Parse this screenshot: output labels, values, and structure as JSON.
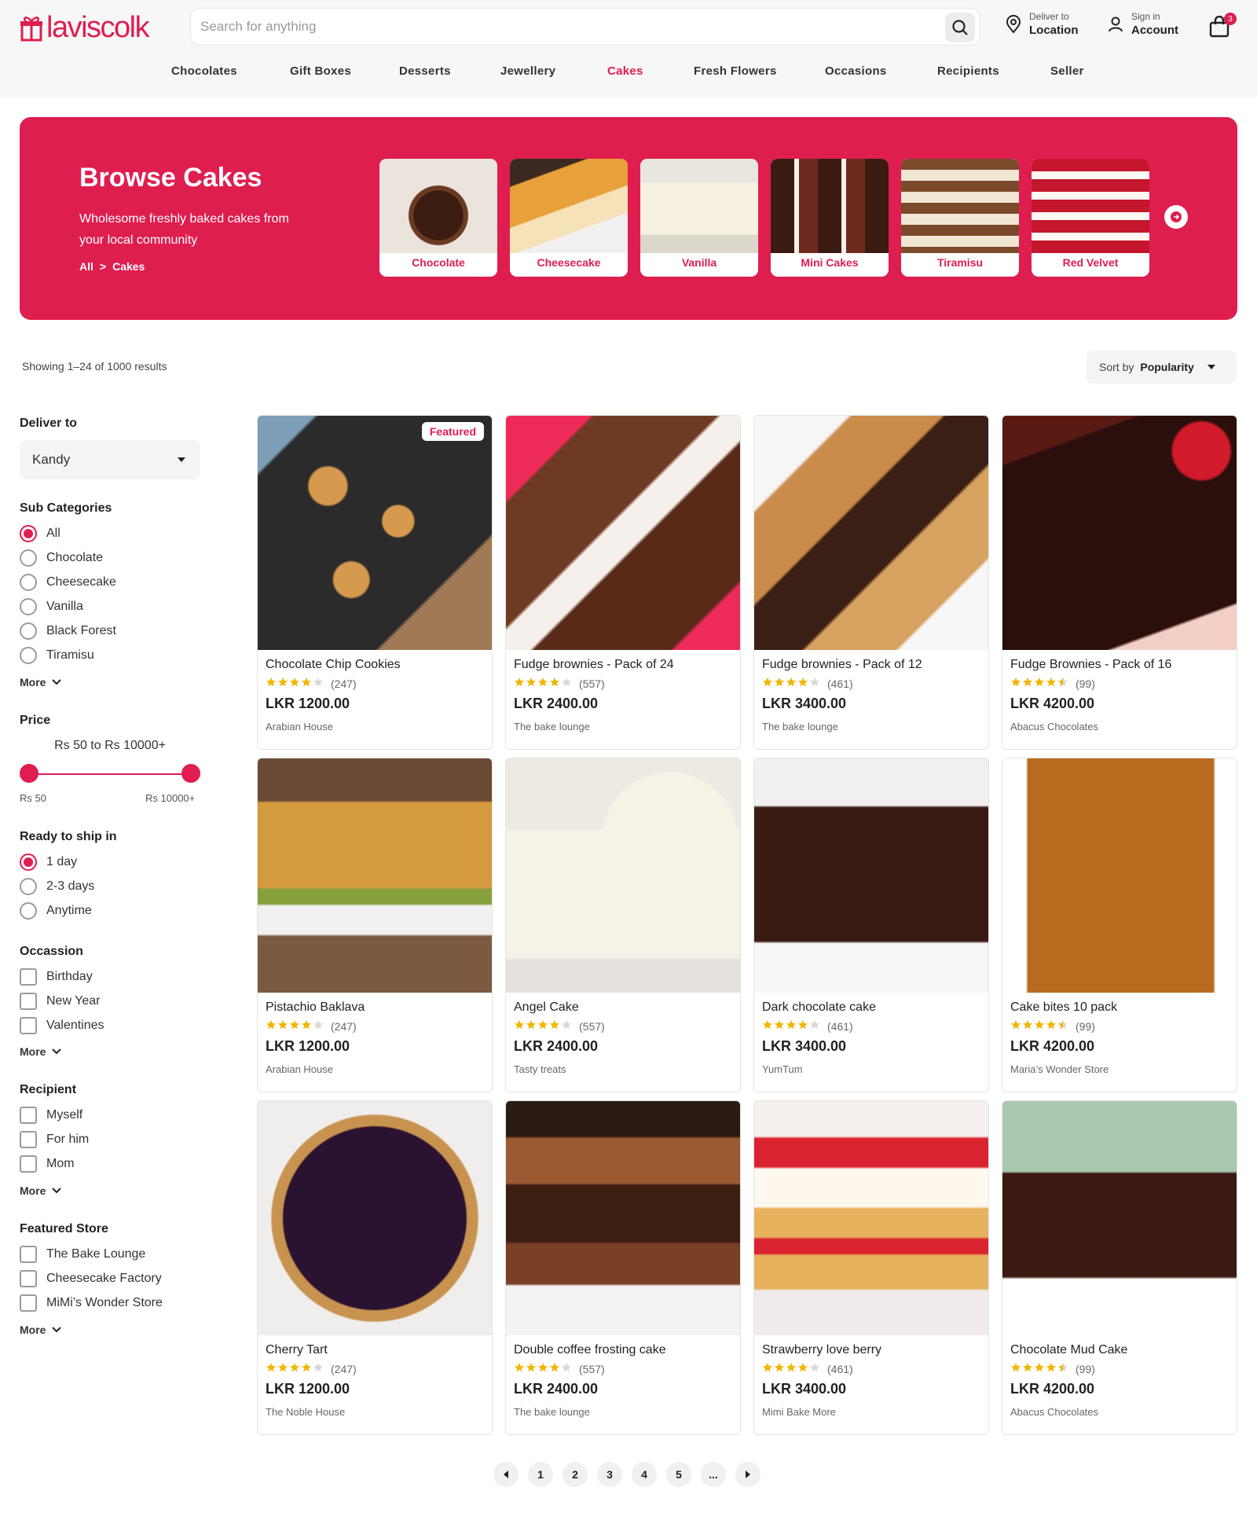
{
  "header": {
    "logo_text": "laviscolk",
    "search_placeholder": "Search for anything",
    "deliver_small": "Deliver to",
    "deliver_big": "Location",
    "account_small": "Sign in",
    "account_big": "Account",
    "cart_count": "3"
  },
  "nav": [
    "Chocolates",
    "Gift Boxes",
    "Desserts",
    "Jewellery",
    "Cakes",
    "Fresh Flowers",
    "Occasions",
    "Recipients",
    "Seller"
  ],
  "hero": {
    "title": "Browse Cakes",
    "subtitle": "Wholesome freshly baked cakes from your local community",
    "crumb_all": "All",
    "crumb_sep": ">",
    "crumb_current": "Cakes",
    "categories": [
      "Chocolate",
      "Cheesecake",
      "Vanilla",
      "Mini Cakes",
      "Tiramisu",
      "Red Velvet"
    ]
  },
  "results_text": "Showing 1–24 of 1000 results",
  "sort": {
    "label": "Sort by",
    "value": "Popularity"
  },
  "filters": {
    "deliver_title": "Deliver to",
    "deliver_value": "Kandy",
    "subcat_title": "Sub Categories",
    "subcats": [
      "All",
      "Chocolate",
      "Cheesecake",
      "Vanilla",
      "Black Forest",
      "Tiramisu"
    ],
    "more": "More",
    "price_title": "Price",
    "price_range": "Rs 50 to Rs 10000+",
    "price_min": "Rs 50",
    "price_max": "Rs 10000+",
    "ship_title": "Ready to ship in",
    "ship": [
      "1 day",
      "2-3 days",
      "Anytime"
    ],
    "occasion_title": "Occassion",
    "occasions": [
      "Birthday",
      "New Year",
      "Valentines"
    ],
    "recipient_title": "Recipient",
    "recipients": [
      "Myself",
      "For him",
      "Mom"
    ],
    "store_title": "Featured Store",
    "stores": [
      "The Bake Lounge",
      "Cheesecake Factory",
      "MiMi’s Wonder Store"
    ]
  },
  "featured_label": "Featured",
  "products": [
    {
      "title": "Chocolate Chip Cookies",
      "rating": 4,
      "reviews": "(247)",
      "price": "LKR 1200.00",
      "store": "Arabian House"
    },
    {
      "title": "Fudge brownies - Pack of 24",
      "rating": 4,
      "reviews": "(557)",
      "price": "LKR 2400.00",
      "store": "The bake lounge"
    },
    {
      "title": "Fudge brownies - Pack of 12",
      "rating": 4,
      "reviews": "(461)",
      "price": "LKR 3400.00",
      "store": "The bake lounge"
    },
    {
      "title": "Fudge Brownies - Pack of 16",
      "rating": 4.5,
      "reviews": "(99)",
      "price": "LKR 4200.00",
      "store": "Abacus Chocolates"
    },
    {
      "title": "Pistachio Baklava",
      "rating": 4,
      "reviews": "(247)",
      "price": "LKR 1200.00",
      "store": "Arabian House"
    },
    {
      "title": "Angel Cake",
      "rating": 4,
      "reviews": "(557)",
      "price": "LKR 2400.00",
      "store": "Tasty treats"
    },
    {
      "title": "Dark chocolate cake",
      "rating": 4,
      "reviews": "(461)",
      "price": "LKR 3400.00",
      "store": "YumTum"
    },
    {
      "title": "Cake bites 10 pack",
      "rating": 4.5,
      "reviews": "(99)",
      "price": "LKR 4200.00",
      "store": "Maria’s Wonder Store"
    },
    {
      "title": "Cherry Tart",
      "rating": 4,
      "reviews": "(247)",
      "price": "LKR 1200.00",
      "store": "The Noble House"
    },
    {
      "title": "Double coffee frosting cake",
      "rating": 4,
      "reviews": "(557)",
      "price": "LKR 2400.00",
      "store": "The bake lounge"
    },
    {
      "title": "Strawberry love berry",
      "rating": 4,
      "reviews": "(461)",
      "price": "LKR 3400.00",
      "store": "Mimi Bake More"
    },
    {
      "title": "Chocolate Mud Cake",
      "rating": 4.5,
      "reviews": "(99)",
      "price": "LKR 4200.00",
      "store": "Abacus Chocolates"
    }
  ],
  "pagination": [
    "1",
    "2",
    "3",
    "4",
    "5",
    "..."
  ],
  "colors": {
    "accent": "#e01d50",
    "star": "#f2b600"
  }
}
